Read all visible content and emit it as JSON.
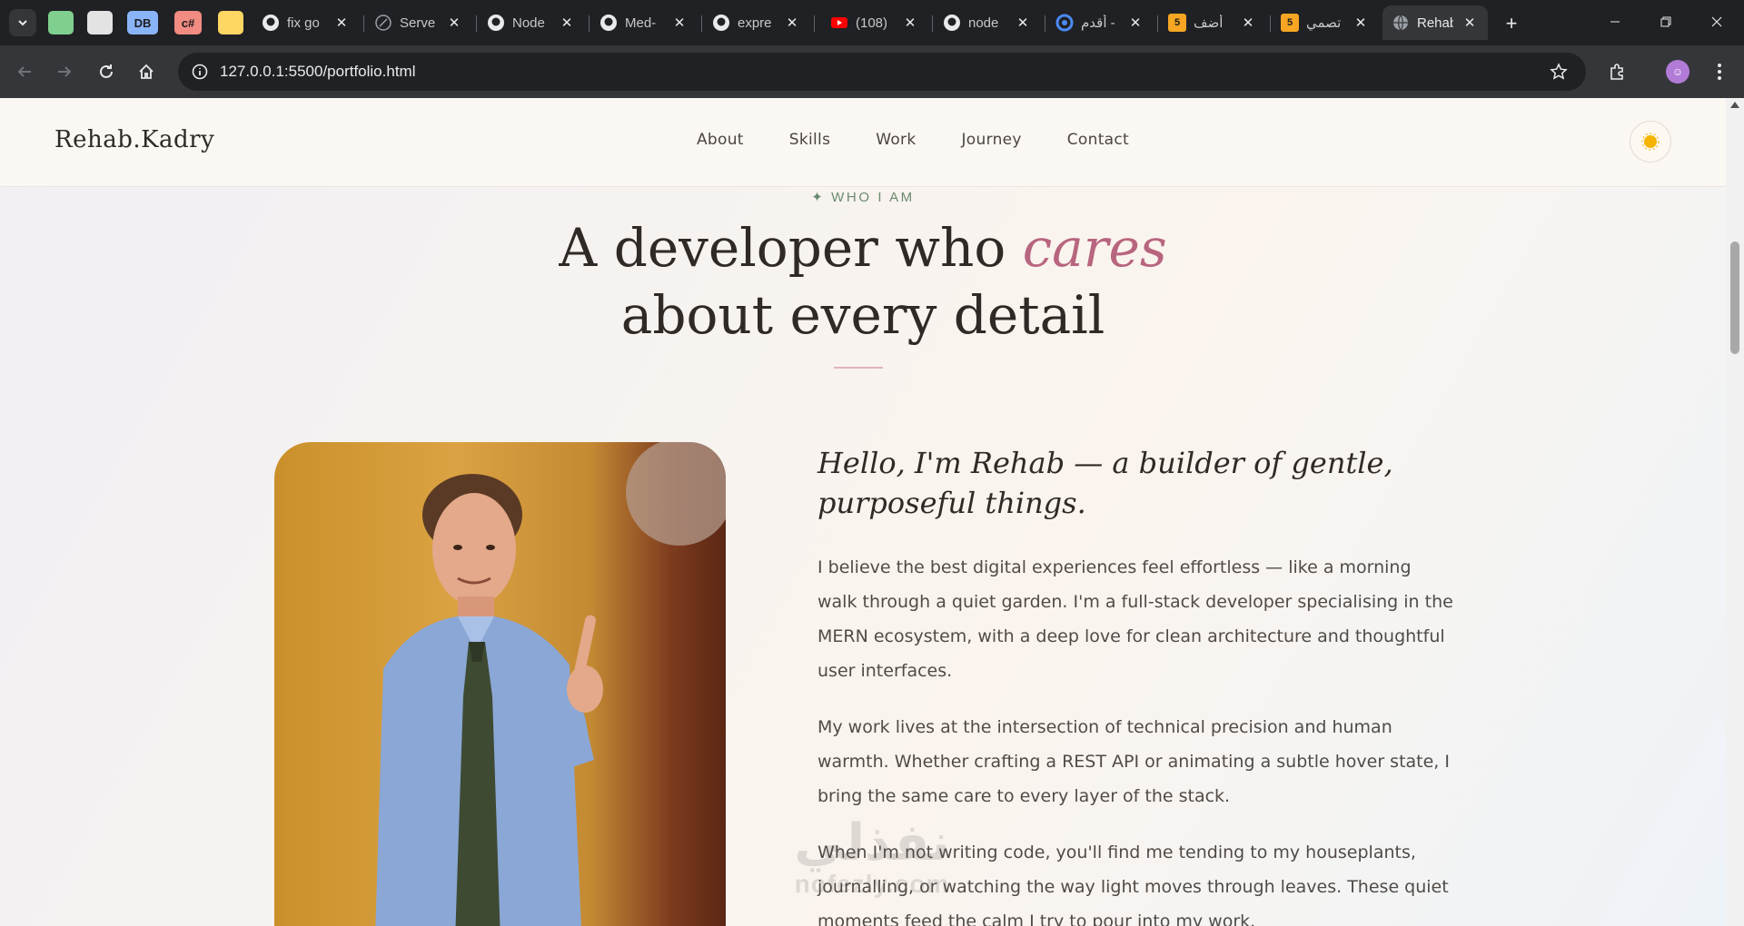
{
  "browser": {
    "pinned_tabs": [
      {
        "label": "",
        "color": "#7fcf8f"
      },
      {
        "label": "",
        "color": "#e3e3e3"
      },
      {
        "label": "DB",
        "color": "#8ab4f8"
      },
      {
        "label": "c#",
        "color": "#f28b82"
      },
      {
        "label": "",
        "color": "#fdd663"
      }
    ],
    "tabs": [
      {
        "title": "fix go",
        "icon": "github-icon"
      },
      {
        "title": "Serve",
        "icon": "server-icon"
      },
      {
        "title": "Node",
        "icon": "github-icon"
      },
      {
        "title": "Med-",
        "icon": "github-icon"
      },
      {
        "title": "expre",
        "icon": "github-icon"
      },
      {
        "title": "(108)",
        "icon": "youtube-icon"
      },
      {
        "title": "node",
        "icon": "github-icon"
      },
      {
        "title": "أقدم -",
        "icon": "app-icon"
      },
      {
        "title": "أضف",
        "icon": "hsoub-icon",
        "badge": "5"
      },
      {
        "title": "تصمي",
        "icon": "hsoub-icon",
        "badge": "5"
      },
      {
        "title": "Rehab",
        "icon": "globe-icon",
        "active": true
      }
    ],
    "url": "127.0.0.1:5500/portfolio.html"
  },
  "site": {
    "logo": "Rehab.Kadry",
    "nav": [
      "About",
      "Skills",
      "Work",
      "Journey",
      "Contact"
    ]
  },
  "about": {
    "eyebrow": "✦ WHO I AM",
    "heading_part1": "A developer who ",
    "heading_emphasis": "cares",
    "heading_part2": "about every detail",
    "intro": "Hello, I'm Rehab — a builder of gentle, purposeful things.",
    "paragraphs": [
      "I believe the best digital experiences feel effortless — like a morning walk through a quiet garden. I'm a full-stack developer specialising in the MERN ecosystem, with a deep love for clean architecture and thoughtful user interfaces.",
      "My work lives at the intersection of technical precision and human warmth. Whether crafting a REST API or animating a subtle hover state, I bring the same care to every layer of the stack.",
      "When I'm not writing code, you'll find me tending to my houseplants, journalling, or watching the way light moves through leaves. These quiet moments feed the calm I try to pour into my work."
    ]
  },
  "watermark": {
    "arabic": "نفذلي",
    "latin": "nofezly.com"
  },
  "colors": {
    "accent": "#b8657f",
    "eyebrow": "#6b8a6e",
    "text": "#2f2a26"
  }
}
